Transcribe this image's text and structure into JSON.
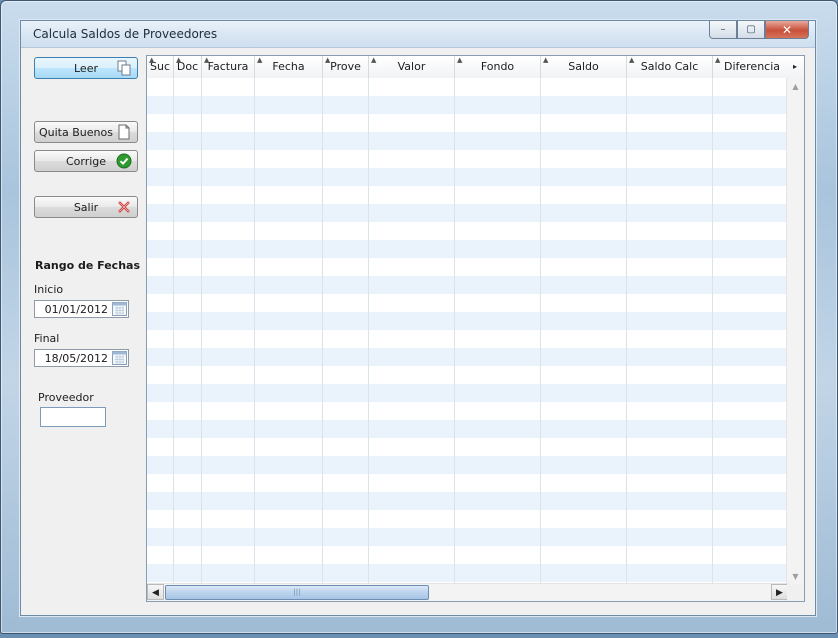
{
  "window": {
    "title": "Calcula Saldos de Proveedores",
    "controls": {
      "minimize": "–",
      "maximize": "▢",
      "close": "✕"
    }
  },
  "sidebar": {
    "leer_label": "Leer",
    "quita_buenos_label": "Quita Buenos",
    "corrige_label": "Corrige",
    "salir_label": "Salir",
    "rango_label": "Rango de Fechas",
    "inicio_label": "Inicio",
    "inicio_value": "01/01/2012",
    "final_label": "Final",
    "final_value": "18/05/2012",
    "proveedor_label": "Proveedor",
    "proveedor_value": ""
  },
  "grid": {
    "columns": [
      "Suc",
      "Doc",
      "Factura",
      "Fecha",
      "Prove",
      "Valor",
      "Fondo",
      "Saldo",
      "Saldo Calc",
      "Diferencia"
    ],
    "rows": [],
    "scroll_right_glyph": "▸"
  },
  "colors": {
    "row_alt": "#eaf3fc",
    "accent": "#3c7fb1",
    "check_green": "#2e9b2e",
    "close_red": "#c7503a"
  },
  "icons": [
    "copy-icon",
    "document-icon",
    "check-icon",
    "close-x-icon",
    "calendar-icon"
  ]
}
